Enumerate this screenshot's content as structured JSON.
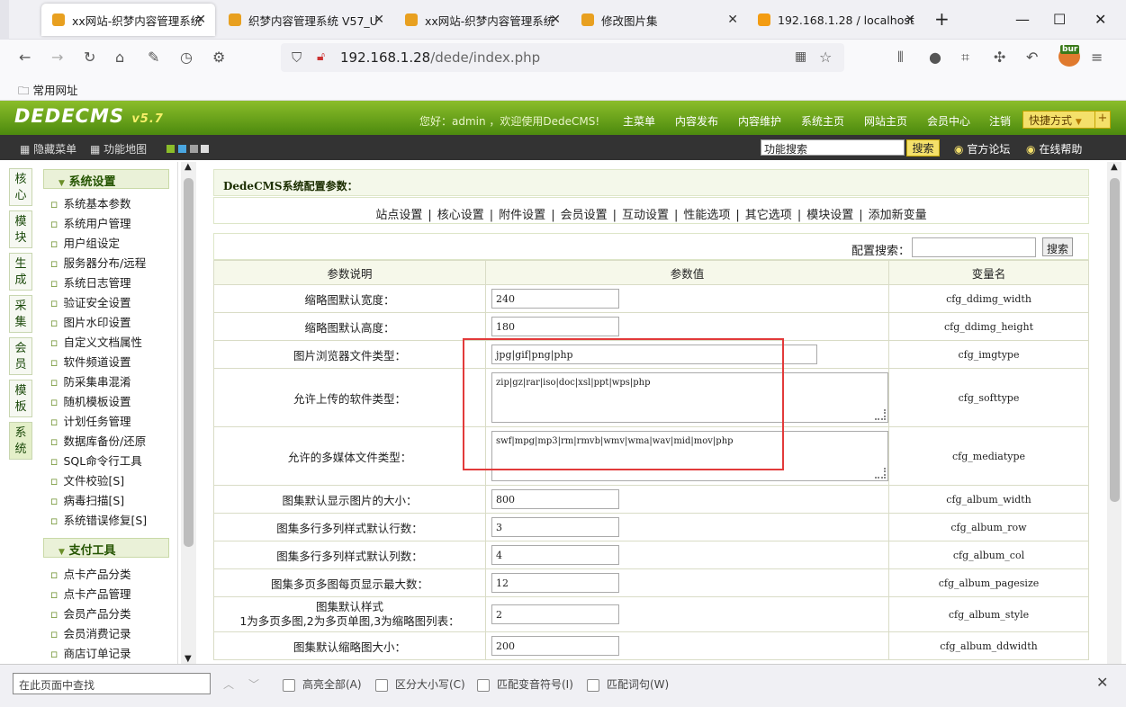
{
  "browser": {
    "tabs": [
      {
        "title": "xx网站-织梦内容管理系统",
        "active": true,
        "color": "#e8a020"
      },
      {
        "title": "织梦内容管理系统 V57_U",
        "active": false,
        "color": "#e8a020"
      },
      {
        "title": "xx网站-织梦内容管理系统",
        "active": false,
        "color": "#e8a020"
      },
      {
        "title": "修改图片集",
        "active": false,
        "color": "#e8a020"
      },
      {
        "title": "192.168.1.28 / localhost",
        "active": false,
        "color": "#f39c12"
      }
    ],
    "url_host": "192.168.1.28",
    "url_path": "/dede/index.php",
    "bookmark": "常用网址",
    "ext_badge": "bur"
  },
  "dede": {
    "logo": "DEDECMS",
    "version": "v5.7",
    "welcome": "您好：admin ，欢迎使用DedeCMS!",
    "topnav": [
      "主菜单",
      "内容发布",
      "内容维护",
      "系统主页",
      "网站主页",
      "会员中心",
      "注销"
    ],
    "quick": "快捷方式",
    "bar_left": [
      "隐藏菜单",
      "功能地图"
    ],
    "search_value": "功能搜索",
    "search_btn": "搜索",
    "bar_right": [
      "官方论坛",
      "在线帮助"
    ]
  },
  "vtabs": [
    "核心",
    "模块",
    "生成",
    "采集",
    "会员",
    "模板",
    "系统"
  ],
  "menu": {
    "group1": "系统设置",
    "items1": [
      "系统基本参数",
      "系统用户管理",
      "用户组设定",
      "服务器分布/远程",
      "系统日志管理",
      "验证安全设置",
      "图片水印设置",
      "自定义文档属性",
      "软件频道设置",
      "防采集串混淆",
      "随机模板设置",
      "计划任务管理",
      "数据库备份/还原",
      "SQL命令行工具",
      "文件校验[S]",
      "病毒扫描[S]",
      "系统错误修复[S]"
    ],
    "group2": "支付工具",
    "items2": [
      "点卡产品分类",
      "点卡产品管理",
      "会员产品分类",
      "会员消费记录",
      "商店订单记录"
    ]
  },
  "main": {
    "title": "DedeCMS系统配置参数：",
    "tabs": [
      "站点设置",
      "核心设置",
      "附件设置",
      "会员设置",
      "互动设置",
      "性能选项",
      "其它选项",
      "模块设置",
      "添加新变量"
    ],
    "cfg_search_label": "配置搜索：",
    "cfg_search_btn": "搜索",
    "headers": [
      "参数说明",
      "参数值",
      "变量名"
    ],
    "rows": [
      {
        "desc": "缩略图默认宽度：",
        "value": "240",
        "var": "cfg_ddimg_width"
      },
      {
        "desc": "缩略图默认高度：",
        "value": "180",
        "var": "cfg_ddimg_height"
      },
      {
        "desc": "图片浏览器文件类型：",
        "value": "jpg|gif|png|php",
        "var": "cfg_imgtype"
      },
      {
        "desc": "允许上传的软件类型：",
        "value": "zip|gz|rar|iso|doc|xsl|ppt|wps|php",
        "var": "cfg_softtype"
      },
      {
        "desc": "允许的多媒体文件类型：",
        "value": "swf|mpg|mp3|rm|rmvb|wmv|wma|wav|mid|mov|php",
        "var": "cfg_mediatype"
      },
      {
        "desc": "图集默认显示图片的大小：",
        "value": "800",
        "var": "cfg_album_width"
      },
      {
        "desc": "图集多行多列样式默认行数：",
        "value": "3",
        "var": "cfg_album_row"
      },
      {
        "desc": "图集多行多列样式默认列数：",
        "value": "4",
        "var": "cfg_album_col"
      },
      {
        "desc": "图集多页多图每页显示最大数：",
        "value": "12",
        "var": "cfg_album_pagesize"
      },
      {
        "desc": "图集默认样式",
        "desc2": "1为多页多图,2为多页单图,3为缩略图列表：",
        "value": "2",
        "var": "cfg_album_style"
      },
      {
        "desc": "图集默认缩略图大小：",
        "value": "200",
        "var": "cfg_album_ddwidth"
      }
    ]
  },
  "findbar": {
    "placeholder": "在此页面中查找",
    "options": [
      "高亮全部(A)",
      "区分大小写(C)",
      "匹配变音符号(I)",
      "匹配词句(W)"
    ]
  }
}
